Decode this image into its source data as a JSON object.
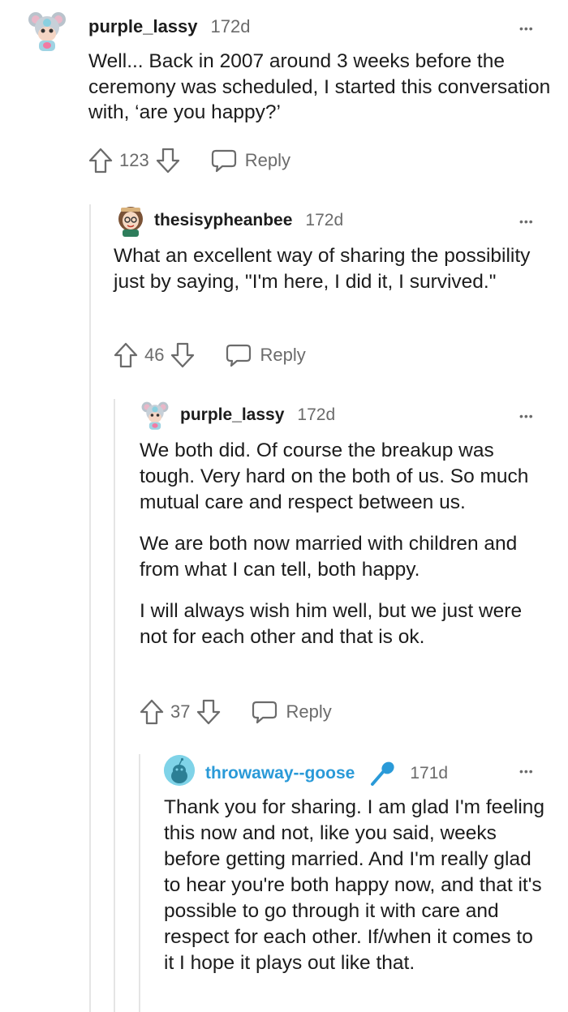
{
  "comments": [
    {
      "username": "purple_lassy",
      "age": "172d",
      "paragraphs": [
        "Well... Back in 2007 around 3 weeks before the ceremony was scheduled, I started this conversation with, ‘are you happy?’"
      ],
      "votes": "123",
      "reply_label": "Reply",
      "more_label": "•••",
      "avatar_icon": "koala-avatar-icon"
    },
    {
      "username": "thesisypheanbee",
      "age": "172d",
      "paragraphs": [
        "What an excellent way of sharing the possibility just by saying, \"I'm here, I did it, I survived.\""
      ],
      "votes": "46",
      "reply_label": "Reply",
      "more_label": "•••",
      "avatar_icon": "girl-avatar-icon"
    },
    {
      "username": "purple_lassy",
      "age": "172d",
      "paragraphs": [
        "We both did. Of course the breakup was tough. Very hard on the both of us. So much mutual care and respect between us.",
        "We are both now married with children and from what I can tell, both happy.",
        "I will always wish him well, but we just were not for each other and that is ok."
      ],
      "votes": "37",
      "reply_label": "Reply",
      "more_label": "•••",
      "avatar_icon": "koala-avatar-icon"
    },
    {
      "username": "throwaway--goose",
      "age": "171d",
      "paragraphs": [
        "Thank you for sharing. I am glad I'm feeling this now and not, like you said, weeks before getting married. And I'm really glad to hear you're both happy now, and that it's possible to go through it with care and respect for each other. If/when it comes to it I hope it plays out like that."
      ],
      "more_label": "•••",
      "avatar_icon": "snoo-avatar-icon",
      "op_icon": "microphone-icon"
    }
  ],
  "colors": {
    "text": "#1c1c1c",
    "meta": "#6b6b6b",
    "op_blue": "#2a9ad8",
    "thread": "#e5e5e5"
  }
}
